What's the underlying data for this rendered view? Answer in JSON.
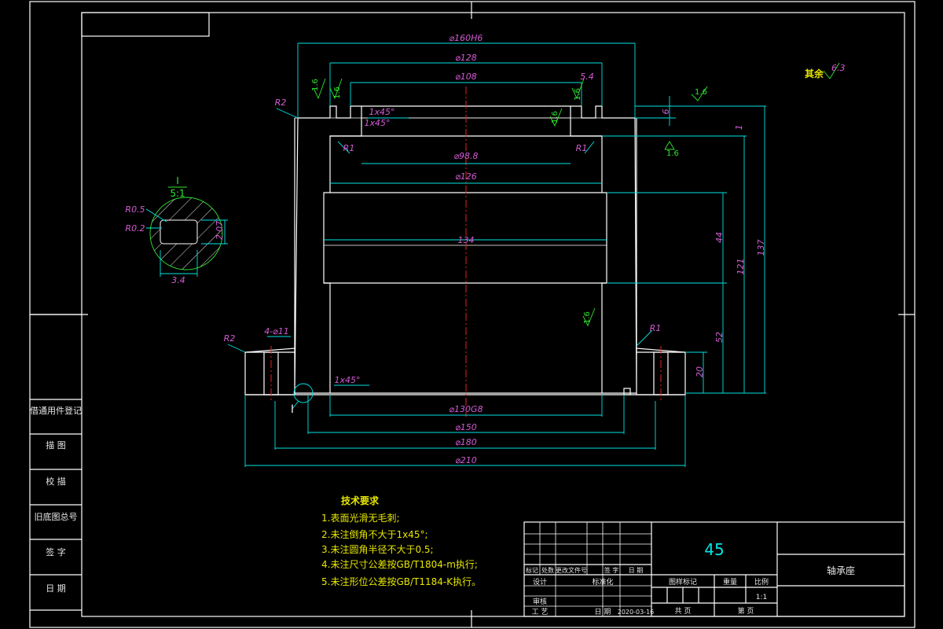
{
  "dimensions": {
    "d160": "⌀160H6",
    "d128": "⌀128",
    "d108": "⌀108",
    "d98_8": "⌀98.8",
    "d126": "⌀126",
    "len134": "134",
    "d130": "⌀130G8",
    "d150": "⌀150",
    "d180": "⌀180",
    "d210": "⌀210",
    "v5_4": "5.4",
    "v6": "6",
    "v1": "1",
    "v44": "44",
    "v121": "121",
    "v137": "137",
    "v52": "52",
    "v20": "20",
    "holes": "4-⌀11",
    "r2_top": "R2",
    "r2_bottom": "R2",
    "r1_left": "R1",
    "r1_right": "R1",
    "r1_bottom": "R1",
    "chamfer1": "1x45°",
    "chamfer2": "1x45°",
    "chamfer3": "1x45°",
    "rough_16a": "1.6",
    "rough_16b": "1.6",
    "rough_16c": "1.6",
    "rough_16d": "1.6",
    "rough_16e": "1.6",
    "rough_16f": "1.6",
    "rough_16g": "1.6"
  },
  "detail": {
    "label": "I",
    "scale": "5:1",
    "r05": "R0.5",
    "r02": "R0.2",
    "w34": "3.4",
    "h207": "2.07",
    "marker": "I"
  },
  "roughness_note": {
    "label": "其余",
    "value": "6.3"
  },
  "tech": {
    "title": "技术要求",
    "items": [
      "1.表面光滑无毛刺;",
      "2.未注倒角不大于1x45°;",
      "3.未注圆角半径不大于0.5;",
      "4.未注尺寸公差按GB/T1804-m执行;",
      "5.未注形位公差按GB/T1184-K执行。"
    ]
  },
  "side_labels": [
    "借通用件登记",
    "描 图",
    "校 描",
    "旧底图总号",
    "签 字",
    "日 期"
  ],
  "title_block": {
    "material": "45",
    "part_name": "轴承座",
    "headers_row": [
      "标记",
      "处数",
      "更改文件号",
      "签 字",
      "日 期"
    ],
    "design": "设计",
    "standard": "标准化",
    "review": "审核",
    "process": "工 艺",
    "date_label": "日 期",
    "date": "2020-03-16",
    "stage_mark": "图样标记",
    "weight": "重量",
    "scale_label": "比例",
    "scale": "1:1",
    "total_sheets": "共 页",
    "sheet_no": "第 页"
  }
}
